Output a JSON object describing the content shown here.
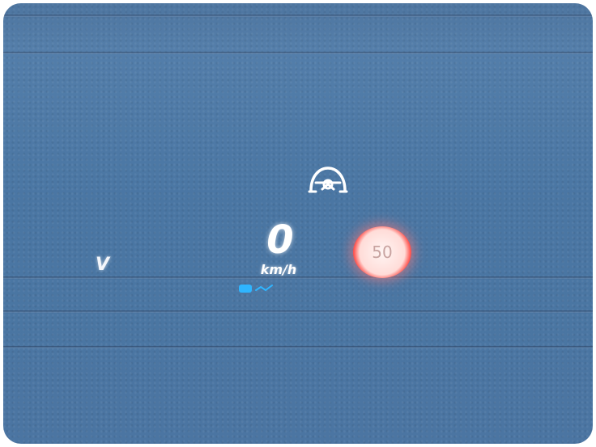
{
  "hud": {
    "gear": "V",
    "speed": "0",
    "speed_unit": "km/h",
    "speed_limit": "50"
  },
  "icons": {
    "driver_assist": "steering-wheel-assist-icon",
    "lane_assist": "lane-assist-icon"
  },
  "colors": {
    "dashboard": "#4a76a3",
    "hud_text": "#ffffff",
    "limit_ring": "#ff3b3b",
    "assist_blue": "#2fb5ff"
  }
}
